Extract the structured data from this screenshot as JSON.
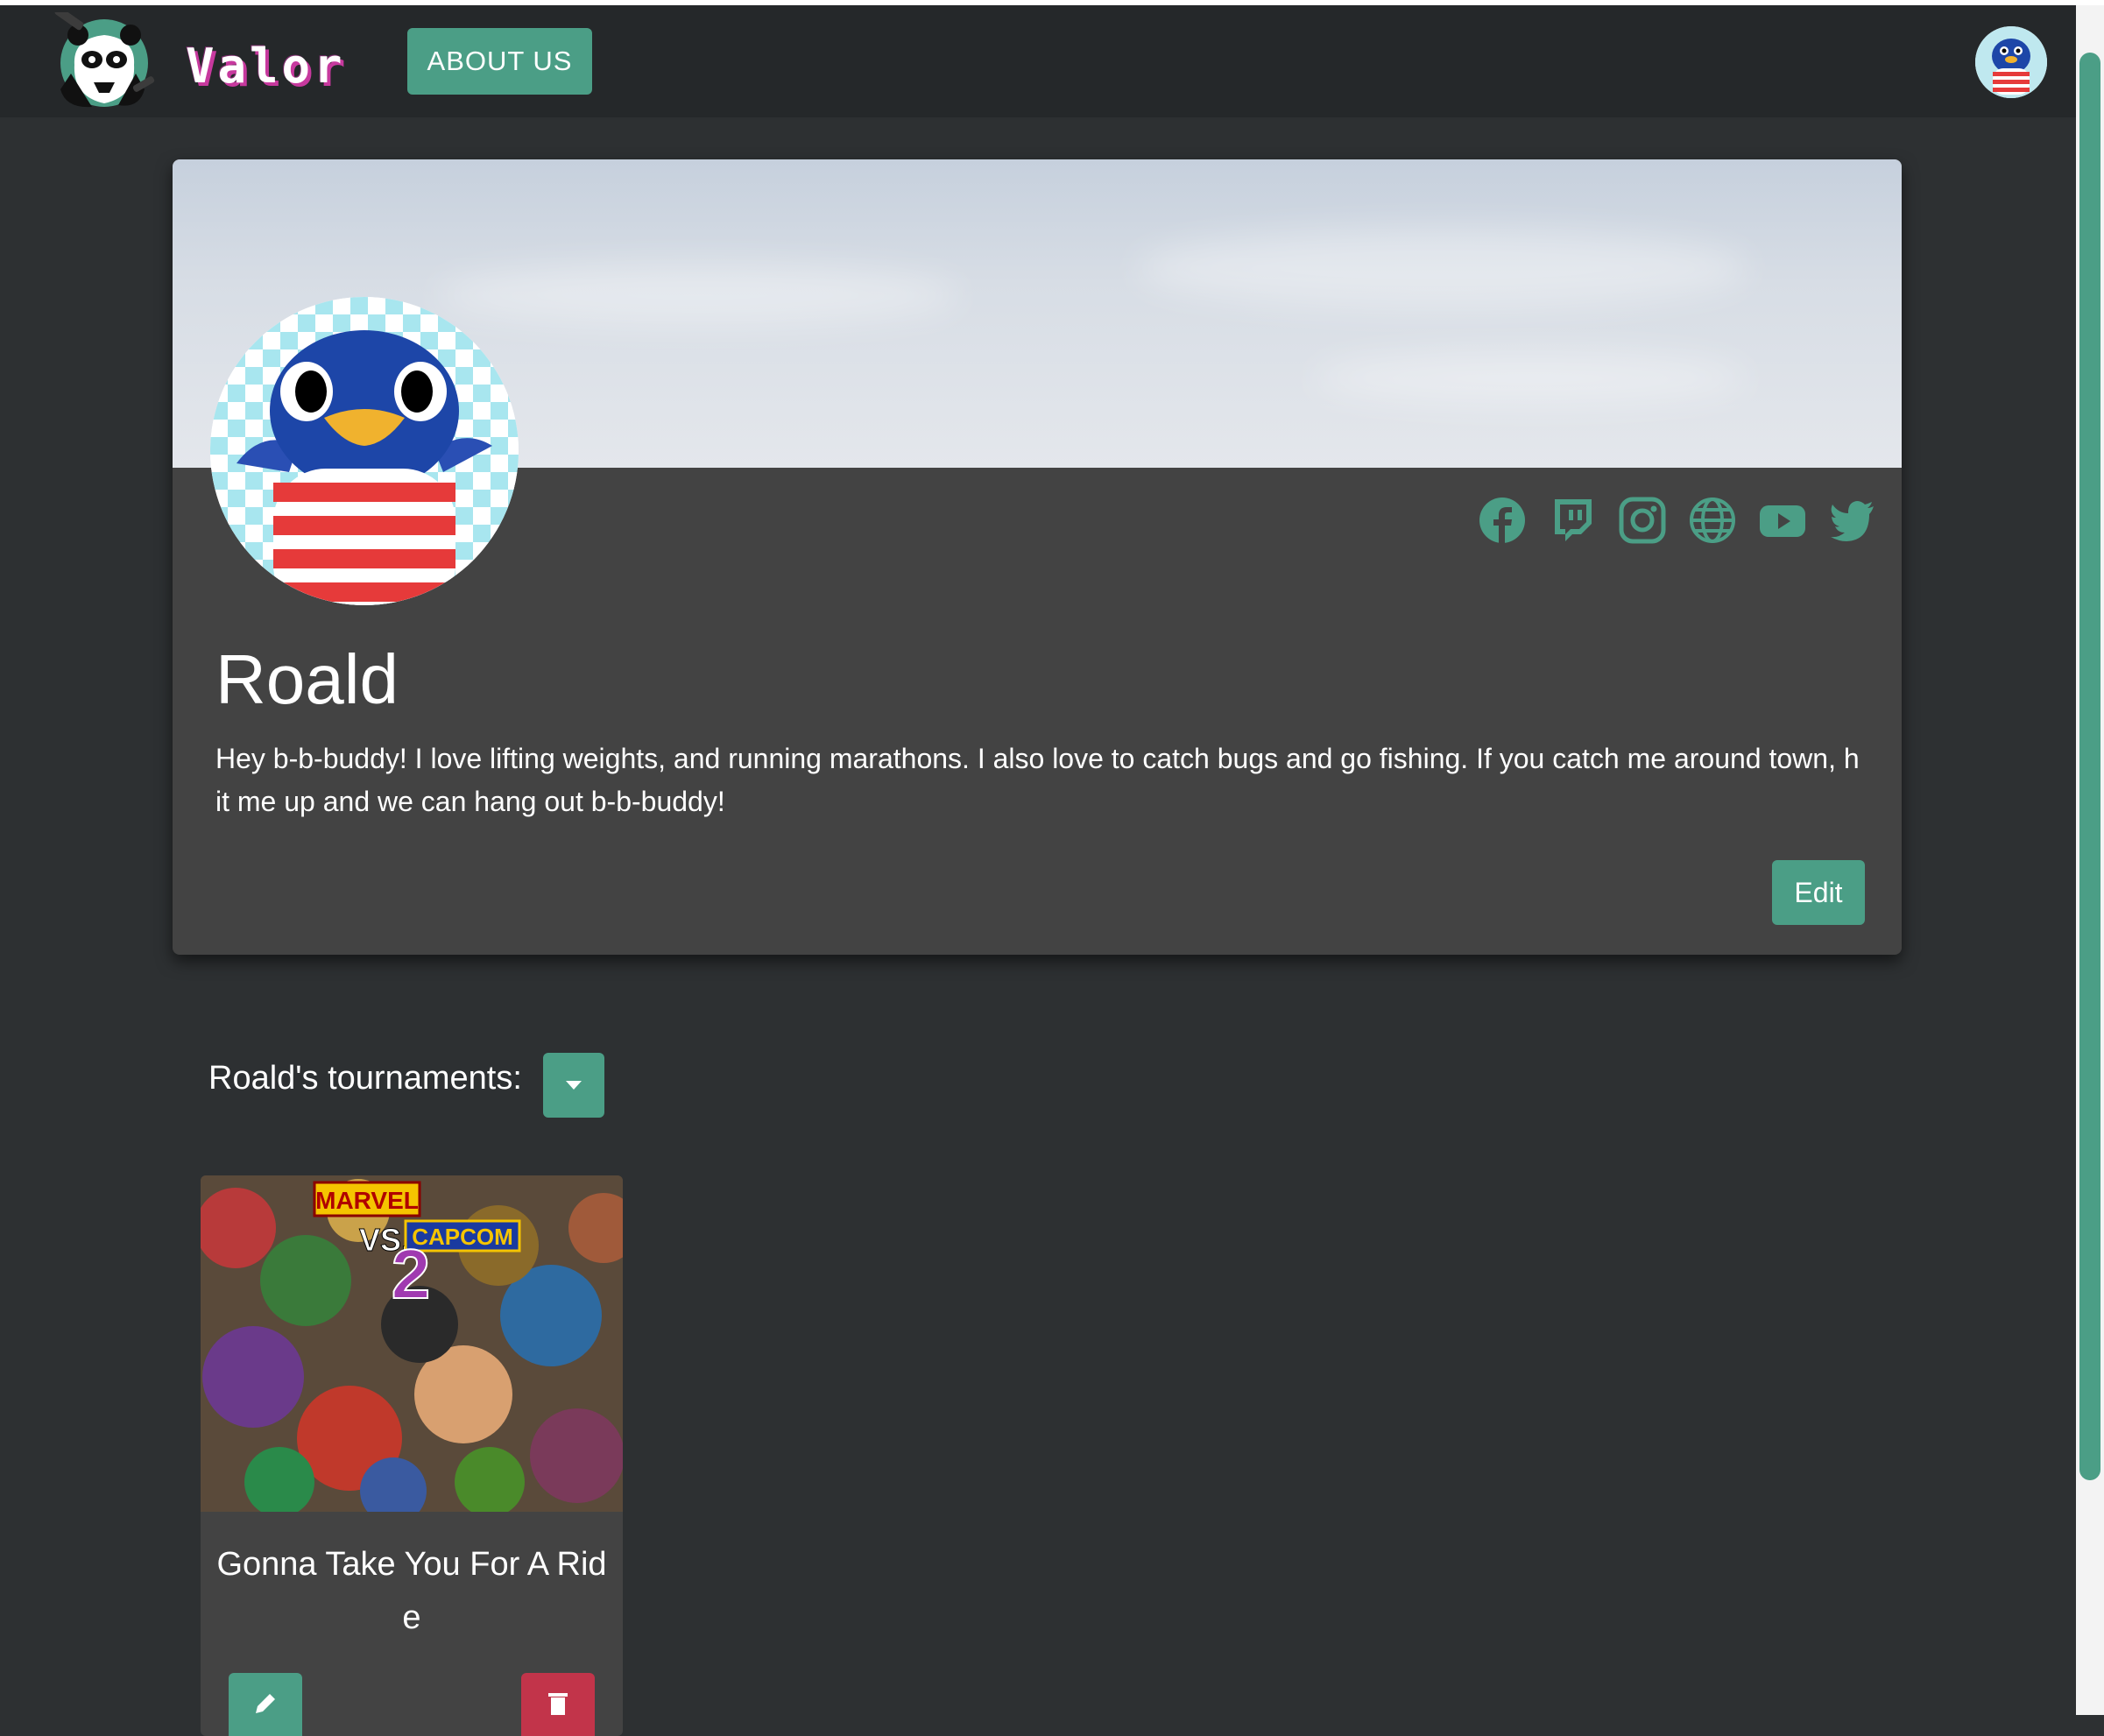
{
  "navbar": {
    "brand": "Valor",
    "about_label": "ABOUT US"
  },
  "profile": {
    "name": "Roald",
    "bio": "Hey b-b-buddy! I love lifting weights, and running marathons. I also love to catch bugs and go fishing. If you catch me around town, hit me up and we can hang out b-b-buddy!",
    "edit_label": "Edit",
    "socials": [
      {
        "icon": "facebook-icon"
      },
      {
        "icon": "twitch-icon"
      },
      {
        "icon": "instagram-icon"
      },
      {
        "icon": "globe-icon"
      },
      {
        "icon": "youtube-icon"
      },
      {
        "icon": "twitter-icon"
      }
    ]
  },
  "tournaments": {
    "label": "Roald's tournaments:",
    "items": [
      {
        "title": "Gonna Take You For A Ride",
        "image_text": [
          "MARVEL",
          "VS.",
          "CAPCOM",
          "2"
        ]
      }
    ]
  },
  "colors": {
    "accent": "#4b9e86",
    "danger": "#c2344a",
    "page_bg": "#2d3032",
    "navbar_bg": "#25282a",
    "card_bg": "#434343"
  }
}
